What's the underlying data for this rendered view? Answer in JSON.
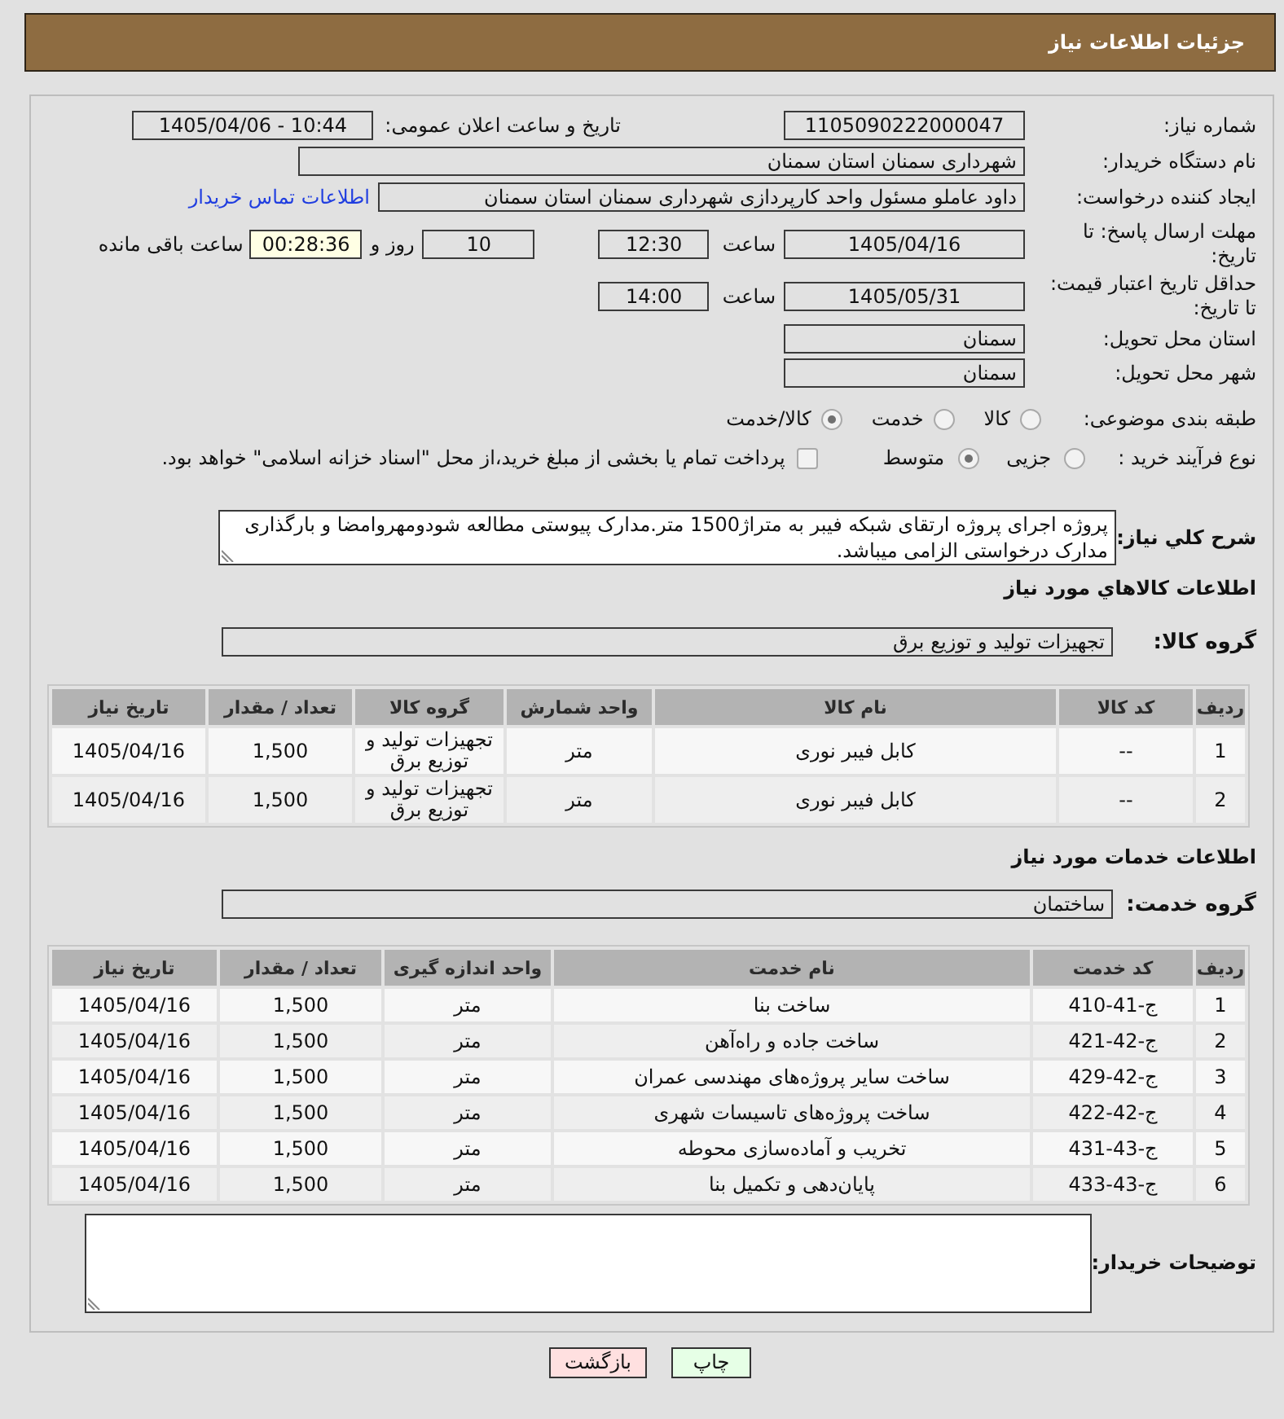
{
  "header": {
    "title": "جزئیات اطلاعات نیاز"
  },
  "need": {
    "number": {
      "label": "شماره نیاز:",
      "value": "1105090222000047"
    },
    "announcement": {
      "label": "تاریخ و ساعت اعلان عمومی:",
      "value": "1405/04/06 - 10:44"
    },
    "buyer": {
      "label": "نام دستگاه خریدار:",
      "value": "شهرداری سمنان استان سمنان"
    },
    "requester": {
      "label": "ایجاد کننده درخواست:",
      "value": "داود عاملو مسئول واحد کارپردازی شهرداری سمنان استان سمنان",
      "link": "اطلاعات تماس خریدار"
    },
    "response_deadline": {
      "label": "مهلت ارسال پاسخ: تا تاریخ:",
      "date": "1405/04/16",
      "time_label": "ساعت",
      "time": "12:30",
      "days": "10",
      "days_label": "روز و",
      "remaining": "00:28:36",
      "remaining_label": "ساعت باقی مانده"
    },
    "price_validity": {
      "label": "حداقل تاریخ اعتبار قیمت: تا تاریخ:",
      "date": "1405/05/31",
      "time_label": "ساعت",
      "time": "14:00"
    },
    "delivery_province": {
      "label": "استان محل تحویل:",
      "value": "سمنان"
    },
    "delivery_city": {
      "label": "شهر محل تحویل:",
      "value": "سمنان"
    },
    "category": {
      "label": "طبقه بندی موضوعی:",
      "options": [
        {
          "label": "کالا",
          "selected": false
        },
        {
          "label": "خدمت",
          "selected": false
        },
        {
          "label": "کالا/خدمت",
          "selected": true
        }
      ]
    },
    "purchase_type": {
      "label": "نوع فرآیند خرید :",
      "options": [
        {
          "label": "جزیی",
          "selected": false
        },
        {
          "label": "متوسط",
          "selected": true
        }
      ],
      "treasury": {
        "label": "پرداخت تمام یا بخشی از مبلغ خرید،از محل \"اسناد خزانه اسلامی\" خواهد بود.",
        "checked": false
      }
    },
    "description": {
      "label": "شرح كلي نياز:",
      "value": "پروژه اجرای پروژه ارتقای شبکه فیبر به متراژ1500 متر.مدارک پیوستی مطالعه شودومهروامضا و بارگذاری مدارک درخواستی الزامی میباشد."
    }
  },
  "goods": {
    "title": "اطلاعات كالاهاي مورد نياز",
    "group_label": "گروه کالا:",
    "group_value": "تجهیزات تولید و توزیع برق",
    "table": {
      "columns": [
        "ردیف",
        "کد کالا",
        "نام کالا",
        "واحد شمارش",
        "گروه کالا",
        "تعداد / مقدار",
        "تاریخ نیاز"
      ],
      "rows": [
        [
          "1",
          "--",
          "کابل فیبر نوری",
          "متر",
          "تجهیزات تولید و توزیع برق",
          "1,500",
          "1405/04/16"
        ],
        [
          "2",
          "--",
          "کابل فیبر نوری",
          "متر",
          "تجهیزات تولید و توزیع برق",
          "1,500",
          "1405/04/16"
        ]
      ]
    }
  },
  "services": {
    "title": "اطلاعات خدمات مورد نیاز",
    "group_label": "گروه خدمت:",
    "group_value": "ساختمان",
    "table": {
      "columns": [
        "ردیف",
        "کد خدمت",
        "نام خدمت",
        "واحد اندازه گیری",
        "تعداد / مقدار",
        "تاریخ نیاز"
      ],
      "rows": [
        [
          "1",
          "ج-41-410",
          "ساخت بنا",
          "متر",
          "1,500",
          "1405/04/16"
        ],
        [
          "2",
          "ج-42-421",
          "ساخت جاده و راه‌آهن",
          "متر",
          "1,500",
          "1405/04/16"
        ],
        [
          "3",
          "ج-42-429",
          "ساخت سایر پروژه‌های مهندسی عمران",
          "متر",
          "1,500",
          "1405/04/16"
        ],
        [
          "4",
          "ج-42-422",
          "ساخت پروژه‌های تاسیسات شهری",
          "متر",
          "1,500",
          "1405/04/16"
        ],
        [
          "5",
          "ج-43-431",
          "تخریب و آماده‌سازی محوطه",
          "متر",
          "1,500",
          "1405/04/16"
        ],
        [
          "6",
          "ج-43-433",
          "پایان‌دهی و تکمیل بنا",
          "متر",
          "1,500",
          "1405/04/16"
        ]
      ]
    }
  },
  "buyer_notes": {
    "label": "توضیحات خریدار:"
  },
  "buttons": [
    {
      "label": "چاپ",
      "kind": "print"
    },
    {
      "label": "بازگشت",
      "kind": "back"
    }
  ]
}
